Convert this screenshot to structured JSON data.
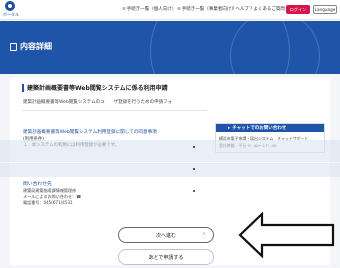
{
  "header": {
    "logo_text": "ポータル",
    "nav": [
      {
        "icon": "list-icon",
        "label": "手続き一覧（個人向け）"
      },
      {
        "icon": "list-icon",
        "label": "手続き一覧（事業者向け）"
      },
      {
        "icon": "help-icon",
        "label": "ヘルプ"
      },
      {
        "icon": "question-icon",
        "label": "よくあるご質問"
      }
    ],
    "login_label": "ログイン",
    "language_label": "Language"
  },
  "banner": {
    "title": "内容詳細"
  },
  "main": {
    "section_title": "建築計画概要書等Web閲覧システムに係る利用申請",
    "description": "建築計画概要書等Web閲覧システムのユ　　ザ登録を行うための申請フォ",
    "link_title": "建築計画概要書等Web閲覧システム利用登録に関しての同意事項",
    "note_heading": "(利用条件)",
    "note_item": "１　本システムの利用には利用登録が必要です。"
  },
  "chat": {
    "title": "チャットでのお問い合わせ",
    "body_line1": "横浜市電子申請・届出システム　チャットサポート",
    "body_line2": "受付時間　平日 9：00～17：00"
  },
  "contact": {
    "heading": "問い合わせ先",
    "lines": [
      "建築局建築指導課情報管理係",
      "メールによるお問い合わせ：☎",
      "電話番号：045(671)4531"
    ]
  },
  "buttons": {
    "next_label": "次へ進む",
    "later_label": "あとで申請する"
  }
}
